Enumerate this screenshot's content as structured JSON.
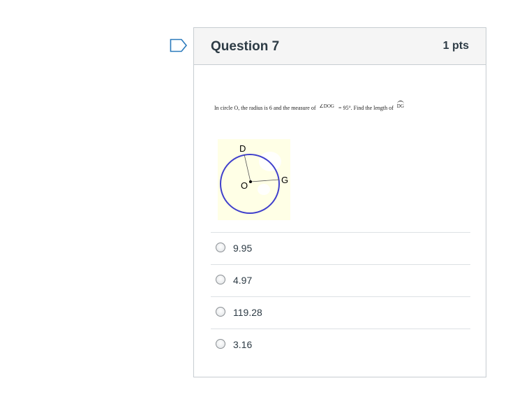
{
  "question": {
    "title": "Question 7",
    "points": "1 pts",
    "text_part1": "In circle O, the radius is 6 and the measure of",
    "angle_expr": "∠DOG",
    "text_part2": "= 95°. Find the length of",
    "arc_expr": "DG"
  },
  "figure": {
    "label_d": "D",
    "label_o": "O",
    "label_g": "G",
    "circle_color": "#4040cc",
    "background_color": "#ffffe6"
  },
  "answers": [
    {
      "label": "9.95",
      "selected": false
    },
    {
      "label": "4.97",
      "selected": false
    },
    {
      "label": "119.28",
      "selected": false
    },
    {
      "label": "3.16",
      "selected": false
    }
  ],
  "icons": {
    "flag": "flag-icon"
  }
}
